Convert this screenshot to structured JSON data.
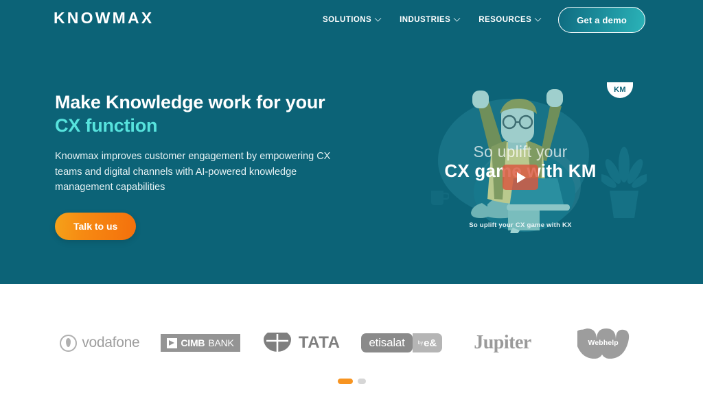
{
  "brand": {
    "name": "KNOWMAX"
  },
  "nav": {
    "items": [
      {
        "label": "SOLUTIONS",
        "has_dropdown": true
      },
      {
        "label": "INDUSTRIES",
        "has_dropdown": true
      },
      {
        "label": "RESOURCES",
        "has_dropdown": true
      }
    ],
    "cta": {
      "label": "Get a demo"
    }
  },
  "hero": {
    "heading_line1": "Make Knowledge work for your",
    "heading_line2": "CX function",
    "subheading": "Knowmax improves customer engagement by empowering CX teams and digital channels with AI-powered knowledge management capabilities",
    "cta": {
      "label": "Talk to us"
    },
    "background_color": "#0c6377",
    "accent_color": "#57e3dd",
    "cta_color": "#f4700c"
  },
  "video": {
    "overlay_line1": "So uplift your",
    "overlay_line2": "CX game with KM",
    "caption": "So uplift your CX game with KX",
    "badge_label": "KM",
    "play_icon": "play-icon",
    "play_button_color": "#db573e"
  },
  "logos": {
    "items": [
      {
        "name": "vodafone",
        "label": "vodafone"
      },
      {
        "name": "cimb-bank",
        "label_bold": "CIMB",
        "label_light": "BANK"
      },
      {
        "name": "tata",
        "label": "TATA"
      },
      {
        "name": "etisalat",
        "label": "etisalat",
        "sub_label_prefix": "by",
        "sub_label": "e&"
      },
      {
        "name": "jupiter",
        "label": "Jupiter"
      },
      {
        "name": "webhelp",
        "label": "Webhelp"
      }
    ]
  },
  "carousel": {
    "dots": [
      {
        "active": true
      },
      {
        "active": false
      }
    ],
    "active_color": "#f79421",
    "inactive_color": "#d6d6d6"
  }
}
